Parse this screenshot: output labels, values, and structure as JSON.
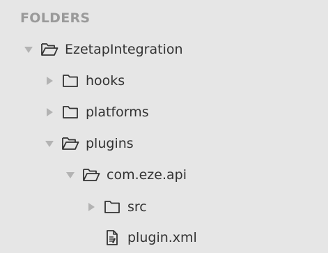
{
  "sidebar": {
    "header": "FOLDERS",
    "tree": {
      "root": {
        "label": "EzetapIntegration",
        "expanded": true
      },
      "hooks": {
        "label": "hooks",
        "expanded": false
      },
      "platforms": {
        "label": "platforms",
        "expanded": false
      },
      "plugins": {
        "label": "plugins",
        "expanded": true
      },
      "com_eze_api": {
        "label": "com.eze.api",
        "expanded": true
      },
      "src": {
        "label": "src",
        "expanded": false
      },
      "plugin_xml": {
        "label": "plugin.xml"
      }
    }
  },
  "colors": {
    "background": "#e6e6e6",
    "header_text": "#9a9a9a",
    "label_text": "#333333",
    "disclosure_arrow": "#b3b3b3",
    "icon_stroke": "#333333"
  },
  "icons": {
    "expanded": "triangle-down",
    "collapsed": "triangle-right",
    "folder_closed": "folder-icon",
    "folder_open": "folder-open-icon",
    "file": "file-icon"
  }
}
